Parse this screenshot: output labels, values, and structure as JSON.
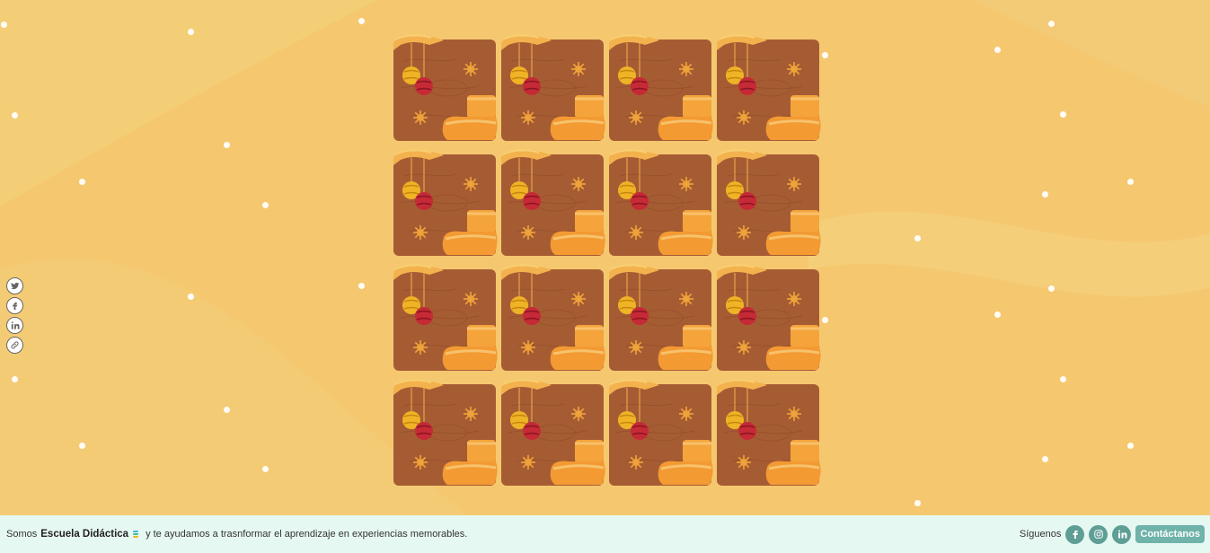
{
  "colors": {
    "background": "#f5c870",
    "card_wood": "#a65c33",
    "footer_bg": "#e6f8f2",
    "social_bg": "#5f9e95",
    "contact_bg": "#6fb3aa"
  },
  "share_bar": {
    "items": [
      {
        "name": "twitter-icon"
      },
      {
        "name": "facebook-icon"
      },
      {
        "name": "linkedin-icon"
      },
      {
        "name": "link-icon"
      }
    ]
  },
  "board": {
    "rows": 4,
    "columns": 4,
    "card_count": 16,
    "card_back": "christmas-ornaments-wood-card-back"
  },
  "footer": {
    "prefix": "Somos",
    "brand": "Escuela Didáctica",
    "tagline": "y te ayudamos a trasnformar el aprendizaje en experiencias memorables.",
    "follow_label": "Síguenos",
    "social": [
      {
        "name": "facebook-icon"
      },
      {
        "name": "instagram-icon"
      },
      {
        "name": "linkedin-icon"
      }
    ],
    "contact_label": "Contáctanos"
  }
}
